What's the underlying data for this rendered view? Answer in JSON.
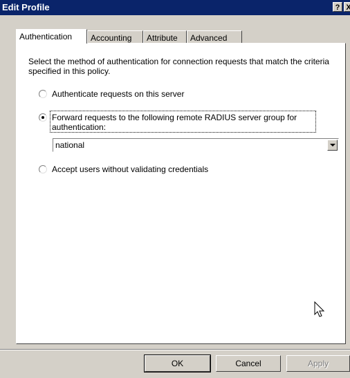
{
  "window": {
    "title": "Edit Profile",
    "help_button": "?",
    "close_button": "X"
  },
  "tabs": [
    {
      "label": "Authentication",
      "active": true
    },
    {
      "label": "Accounting",
      "active": false
    },
    {
      "label": "Attribute",
      "active": false
    },
    {
      "label": "Advanced",
      "active": false
    }
  ],
  "authentication": {
    "description": "Select the method of authentication for connection requests that match the criteria specified in this policy.",
    "options": [
      {
        "label": "Authenticate requests on this server",
        "selected": false
      },
      {
        "label": "Forward requests to the following remote RADIUS server group for authentication:",
        "selected": true
      },
      {
        "label": "Accept users without validating credentials",
        "selected": false
      }
    ],
    "server_group": {
      "selected_value": "national"
    }
  },
  "buttons": {
    "ok": "OK",
    "cancel": "Cancel",
    "apply": "Apply"
  }
}
